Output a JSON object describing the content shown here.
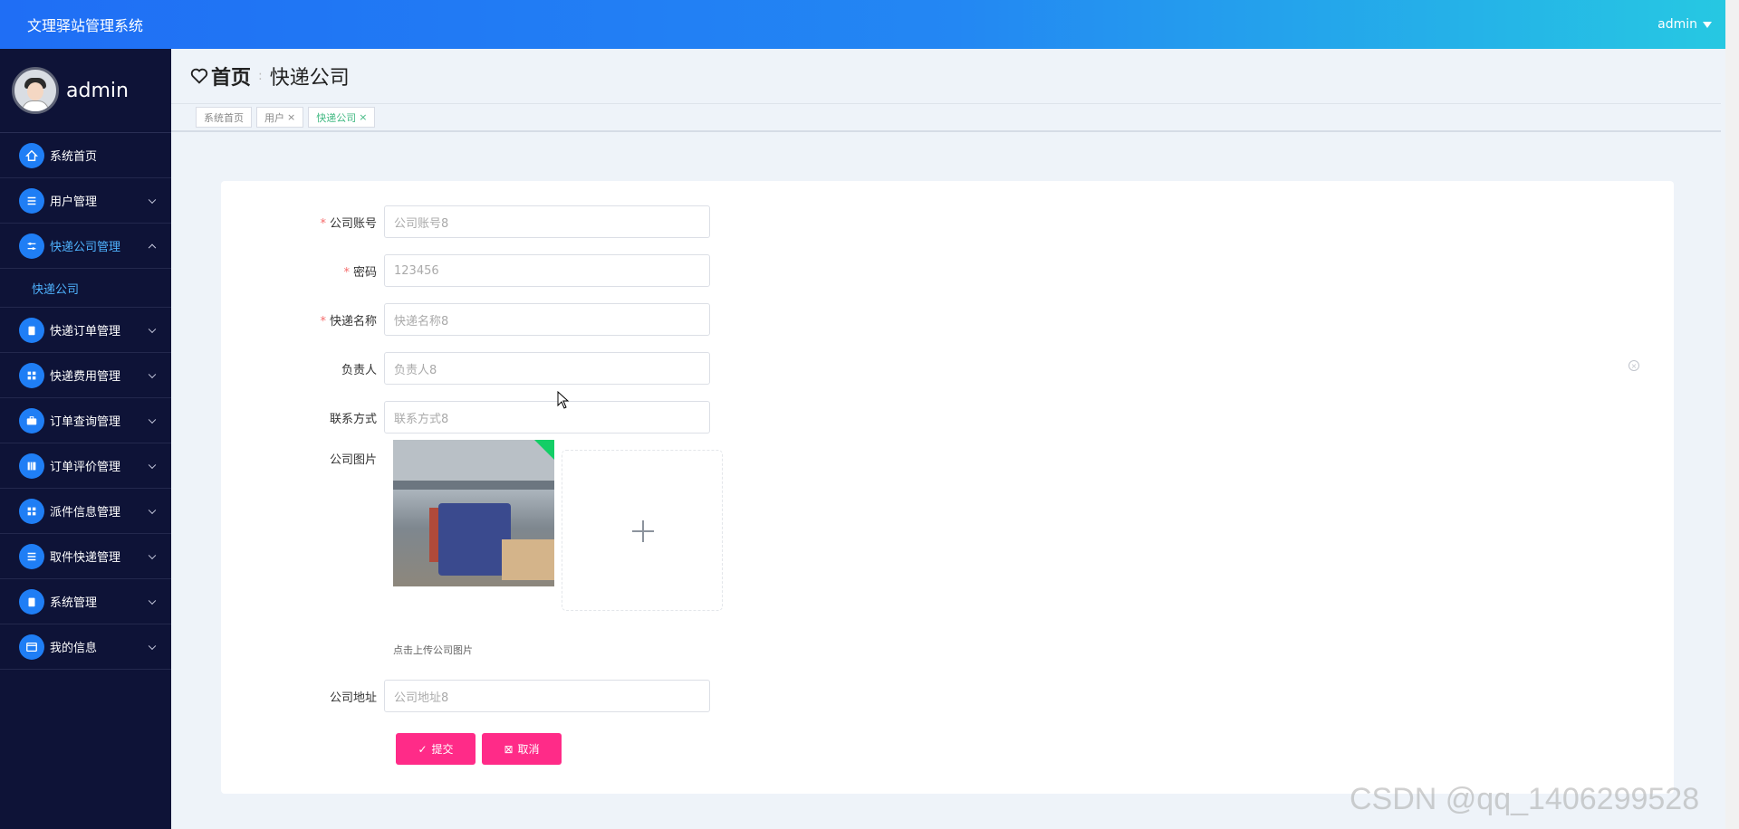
{
  "app": {
    "title": "文理驿站管理系统",
    "user_menu": "admin"
  },
  "sidebar": {
    "profile_name": "admin",
    "items": [
      {
        "label": "系统首页",
        "icon": "home-icon",
        "expandable": false
      },
      {
        "label": "用户管理",
        "icon": "list-icon",
        "expandable": true
      },
      {
        "label": "快递公司管理",
        "icon": "sliders-icon",
        "expandable": true,
        "expanded": true,
        "active": true
      },
      {
        "label": "快递订单管理",
        "icon": "clipboard-icon",
        "expandable": true
      },
      {
        "label": "快递费用管理",
        "icon": "grid-icon",
        "expandable": true
      },
      {
        "label": "订单查询管理",
        "icon": "briefcase-icon",
        "expandable": true
      },
      {
        "label": "订单评价管理",
        "icon": "book-icon",
        "expandable": true
      },
      {
        "label": "派件信息管理",
        "icon": "grid-icon",
        "expandable": true
      },
      {
        "label": "取件快递管理",
        "icon": "list-icon",
        "expandable": true
      },
      {
        "label": "系统管理",
        "icon": "clipboard-icon",
        "expandable": true
      },
      {
        "label": "我的信息",
        "icon": "card-icon",
        "expandable": true
      }
    ],
    "submenu": {
      "label": "快递公司"
    }
  },
  "breadcrumb": {
    "home": "首页",
    "current": "快递公司"
  },
  "tabs": [
    {
      "label": "系统首页",
      "closable": false
    },
    {
      "label": "用户",
      "closable": true
    },
    {
      "label": "快递公司",
      "closable": true,
      "active": true
    }
  ],
  "form": {
    "account": {
      "label": "公司账号",
      "required": true,
      "placeholder": "公司账号8"
    },
    "password": {
      "label": "密码",
      "required": true,
      "value": "123456"
    },
    "express_name": {
      "label": "快递名称",
      "required": true,
      "placeholder": "快递名称8"
    },
    "manager": {
      "label": "负责人",
      "placeholder": "负责人8"
    },
    "contact": {
      "label": "联系方式",
      "placeholder": "联系方式8"
    },
    "image": {
      "label": "公司图片",
      "hint": "点击上传公司图片"
    },
    "address": {
      "label": "公司地址",
      "placeholder": "公司地址8"
    },
    "submit_label": "提交",
    "cancel_label": "取消"
  },
  "colors": {
    "topbar_start": "#1f6ef5",
    "topbar_end": "#26c9e2",
    "sidebar_bg": "#0e1337",
    "accent_button": "#ff2b88",
    "active_tab": "#42b983"
  },
  "watermark": "CSDN @qq_1406299528"
}
